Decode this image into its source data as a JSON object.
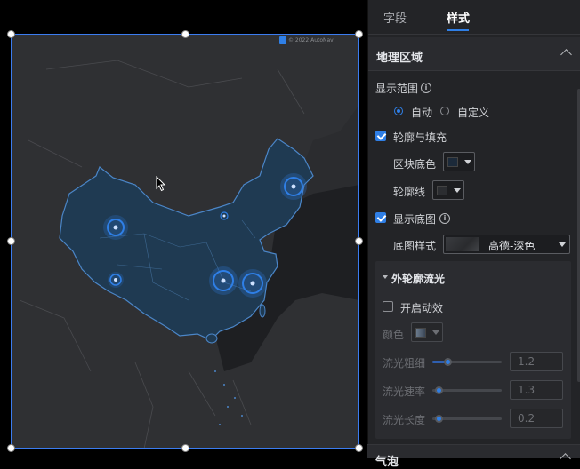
{
  "tabs": {
    "fields": "字段",
    "style": "样式"
  },
  "geo_section": {
    "title": "地理区域",
    "range_label": "显示范围",
    "range_options": [
      "自动",
      "自定义"
    ],
    "range_selected": "自动",
    "outline_fill_label": "轮廓与填充",
    "outline_fill_checked": true,
    "block_color_label": "区块底色",
    "block_color": "#1c2a3a",
    "outline_label": "轮廓线",
    "outline_color": "#2b2d31",
    "show_basemap_label": "显示底图",
    "show_basemap_checked": true,
    "basemap_style_label": "底图样式",
    "basemap_style_value": "高德-深色"
  },
  "flow_section": {
    "title": "外轮廓流光",
    "enable_label": "开启动效",
    "enable_checked": false,
    "color_label": "颜色",
    "width_label": "流光粗细",
    "width_value": "1.2",
    "speed_label": "流光速率",
    "speed_value": "1.3",
    "length_label": "流光长度",
    "length_value": "0.2"
  },
  "next_section": {
    "title": "气泡"
  },
  "map": {
    "watermark": "© 2022 AutoNavi",
    "region_fill": "#1f3a52",
    "region_stroke": "#4b86c8",
    "bubble_color": "#2f7fe6"
  },
  "colors": {
    "accent": "#2f7fe6",
    "panel_bg": "#232427",
    "map_bg": "#2b2c2f"
  }
}
